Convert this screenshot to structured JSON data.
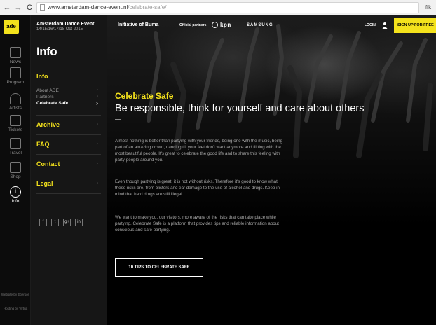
{
  "browser": {
    "back": "←",
    "forward": "→",
    "reload": "C",
    "url_host": "www.amsterdam-dance-event.nl",
    "url_path": "/celebrate-safe/",
    "ext_label": "ffk"
  },
  "rail": {
    "logo": "ade",
    "items": [
      {
        "label": "News",
        "icon": "news-icon"
      },
      {
        "label": "Program",
        "icon": "program-icon"
      },
      {
        "label": "Artists",
        "icon": "artists-icon"
      },
      {
        "label": "Tickets",
        "icon": "tickets-icon"
      },
      {
        "label": "Travel",
        "icon": "travel-icon"
      },
      {
        "label": "Shop",
        "icon": "shop-icon"
      },
      {
        "label": "Info",
        "icon": "info-icon",
        "glyph": "i"
      }
    ],
    "credit_1": "Website by Eberson",
    "credit_2": "Hosting by Virtua"
  },
  "panel": {
    "event_name": "Amsterdam Dance Event",
    "event_dates": "14/15/16/17/18 Oct 2015",
    "title": "Info",
    "info_heading": "Info",
    "info_items": [
      {
        "label": "About ADE",
        "chev": "›"
      },
      {
        "label": "Partners",
        "chev": "›"
      },
      {
        "label": "Celebrate Safe",
        "chev": "›"
      }
    ],
    "sections": [
      {
        "label": "Archive",
        "chev": "›"
      },
      {
        "label": "FAQ",
        "chev": "›"
      },
      {
        "label": "Contact",
        "chev": "›"
      },
      {
        "label": "Legal",
        "chev": "›"
      }
    ],
    "social": [
      "f",
      "t",
      "g+",
      "in"
    ]
  },
  "topbar": {
    "initiative": "Initiative of Buma",
    "partners": "Official partners",
    "kpn": "kpn",
    "samsung": "SAMSUNG",
    "login": "LOGIN",
    "signup": "SIGN UP FOR FREE"
  },
  "hero": {
    "title": "Celebrate Safe",
    "subtitle": "Be responsible, think for yourself and care about others"
  },
  "body": {
    "paragraphs": [
      "Almost nothing is better than partying with your friends, being one with the music, being part of an amazing crowd, dancing till your feet don't want anymore and flirting with the most beautiful people. It's great to celebrate the good life and to share this feeling with party-people around you.",
      "Even though partying is great, it is not without risks. Therefore it's good to know what these risks are, from blisters and ear damage to the use of alcohol and drugs. Keep in mind that hard drugs are still illegal.",
      "We want to make you, our visitors, more aware of the risks that can take place while partying. Celebrate Safe is a platform that provides tips and reliable information about conscious and safe partying."
    ],
    "cta": "10 TIPS TO CELEBRATE SAFE"
  },
  "colors": {
    "accent": "#f4e21c",
    "background": "#000000",
    "panel": "#161616"
  }
}
